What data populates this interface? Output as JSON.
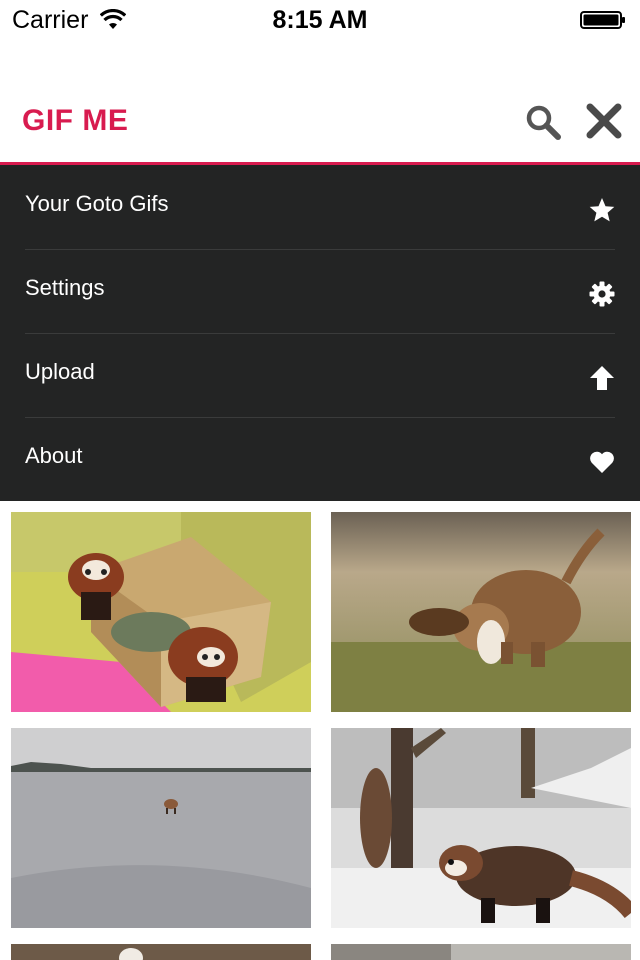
{
  "status_bar": {
    "carrier": "Carrier",
    "time": "8:15 AM"
  },
  "header": {
    "brand": "GIF ME",
    "brand_color": "#d81b4f",
    "actions": [
      "search-icon",
      "close-icon"
    ]
  },
  "menu": {
    "background": "#232424",
    "items": [
      {
        "label": "Your Goto Gifs",
        "icon": "star-icon"
      },
      {
        "label": "Settings",
        "icon": "gear-icon"
      },
      {
        "label": "Upload",
        "icon": "upload-arrow-icon"
      },
      {
        "label": "About",
        "icon": "heart-icon"
      }
    ]
  },
  "gifs": [
    {
      "subject": "red pandas in cardboard box"
    },
    {
      "subject": "basset hound running"
    },
    {
      "subject": "fox on frozen lake"
    },
    {
      "subject": "red pandas in snow"
    }
  ]
}
